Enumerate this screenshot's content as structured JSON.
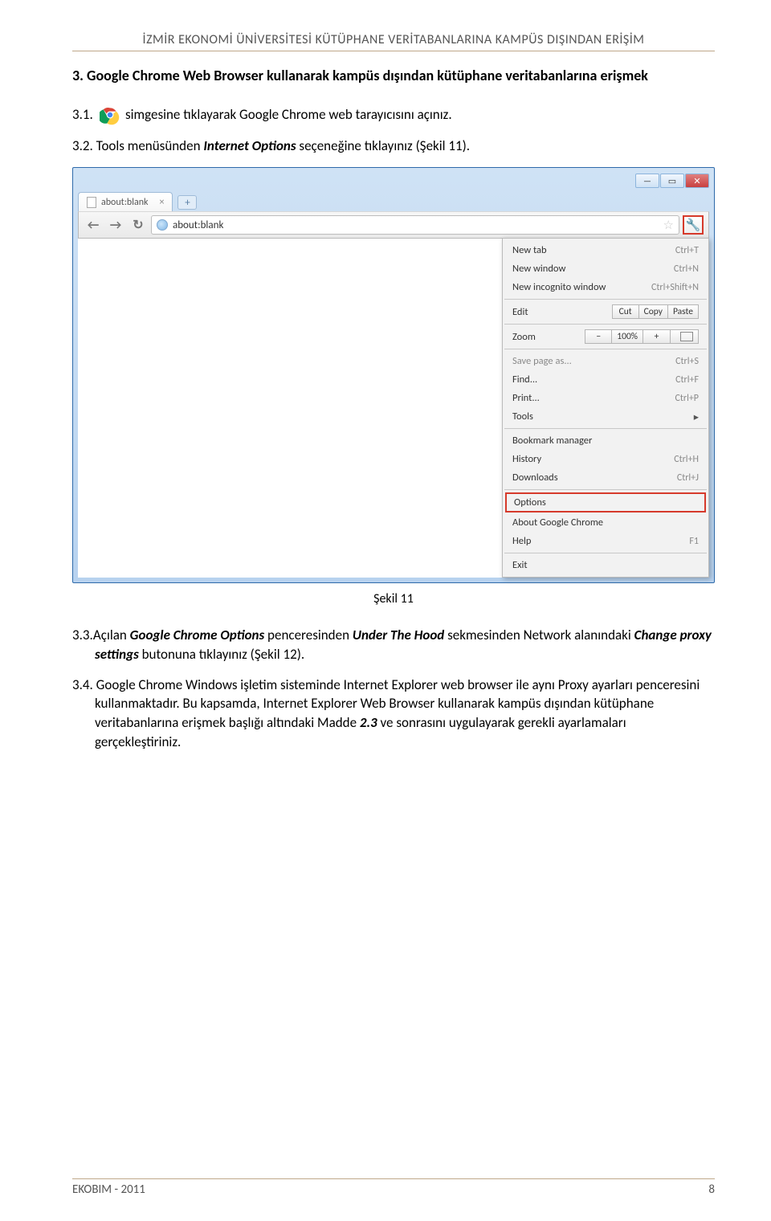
{
  "header": "İZMİR EKONOMİ ÜNİVERSİTESİ KÜTÜPHANE VERİTABANLARINA KAMPÜS DIŞINDAN ERİŞİM",
  "section": {
    "num": "3.",
    "title": "Google Chrome Web Browser kullanarak kampüs dışından kütüphane veritabanlarına erişmek"
  },
  "steps": {
    "s31": {
      "num": "3.1.",
      "text": "simgesine tıklayarak Google Chrome web tarayıcısını açınız."
    },
    "s32": {
      "num": "3.2.",
      "pre": "Tools menüsünden ",
      "term": "Internet Options",
      "post": "  seçeneğine tıklayınız (Şekil 11)."
    },
    "s33": {
      "num": "3.3.",
      "pre": "Açılan ",
      "t1": "Google Chrome Options",
      "mid1": " penceresinden ",
      "t2": "Under The Hood",
      "mid2": " sekmesinden Network alanındaki ",
      "t3": "Change proxy settings",
      "post": " butonuna tıklayınız (Şekil 12)."
    },
    "s34": {
      "num": "3.4.",
      "l1": "Google Chrome Windows işletim sisteminde  Internet Explorer web browser ile aynı Proxy ayarları penceresini kullanmaktadır. Bu kapsamda, Internet Explorer Web Browser kullanarak kampüs dışından kütüphane veritabanlarına erişmek başlığı altındaki Madde ",
      "mref": "2.3",
      "l2": " ve sonrasını uygulayarak gerekli ayarlamaları gerçekleştiriniz."
    }
  },
  "caption": "Şekil 11",
  "chrome": {
    "tab_title": "about:blank",
    "addr": "about:blank",
    "menu": {
      "new_tab": "New tab",
      "new_tab_sc": "Ctrl+T",
      "new_window": "New window",
      "new_window_sc": "Ctrl+N",
      "incognito": "New incognito window",
      "incognito_sc": "Ctrl+Shift+N",
      "edit": "Edit",
      "cut": "Cut",
      "copy": "Copy",
      "paste": "Paste",
      "zoom": "Zoom",
      "zoom_val": "100%",
      "save": "Save page as...",
      "save_sc": "Ctrl+S",
      "find": "Find...",
      "find_sc": "Ctrl+F",
      "print": "Print...",
      "print_sc": "Ctrl+P",
      "tools": "Tools",
      "bookmark": "Bookmark manager",
      "history": "History",
      "history_sc": "Ctrl+H",
      "downloads": "Downloads",
      "downloads_sc": "Ctrl+J",
      "options": "Options",
      "about": "About Google Chrome",
      "help": "Help",
      "help_sc": "F1",
      "exit": "Exit"
    }
  },
  "footer": {
    "left": "EKOBIM - 2011",
    "right": "8"
  }
}
